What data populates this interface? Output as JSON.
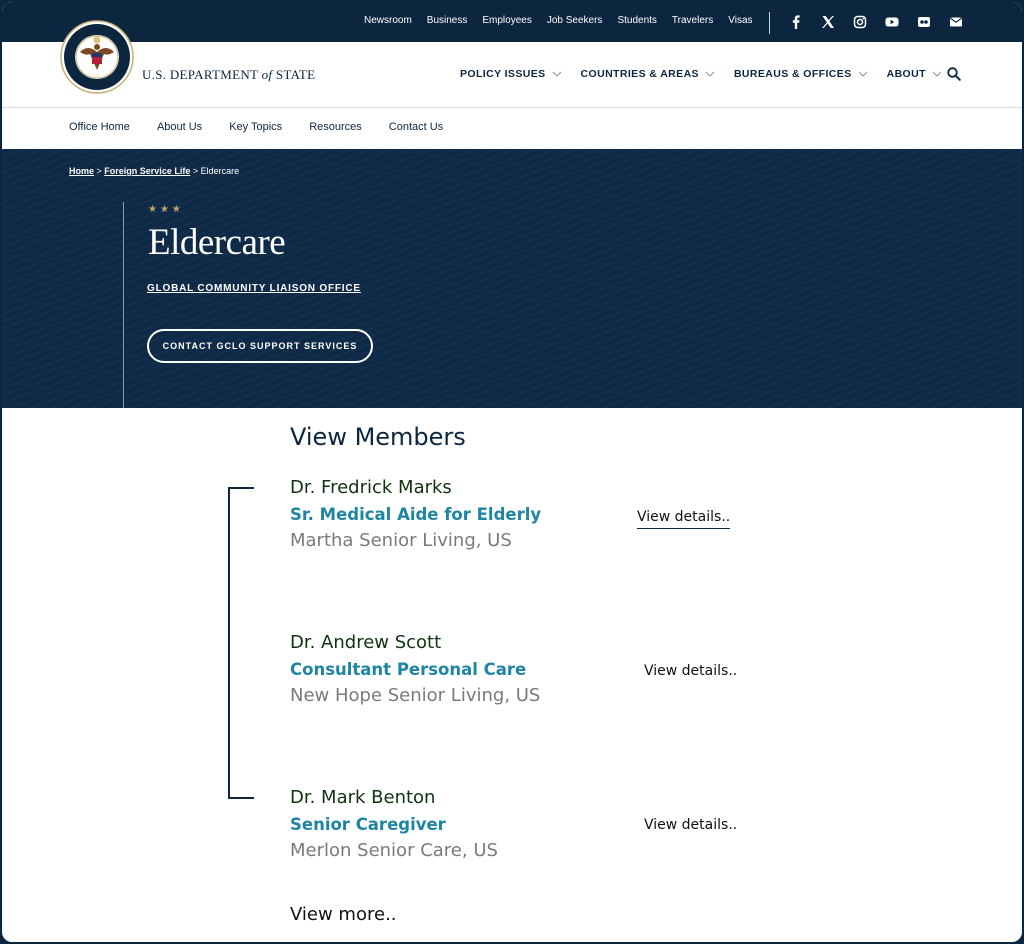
{
  "utility": {
    "links": [
      "Newsroom",
      "Business",
      "Employees",
      "Job Seekers",
      "Students",
      "Travelers",
      "Visas"
    ],
    "social": [
      "facebook-icon",
      "x-icon",
      "instagram-icon",
      "youtube-icon",
      "flickr-icon",
      "email-icon"
    ]
  },
  "header": {
    "brand_main": "U.S. DEPARTMENT",
    "brand_of": "of",
    "brand_state": "STATE",
    "nav": [
      "POLICY ISSUES",
      "COUNTRIES & AREAS",
      "BUREAUS & OFFICES",
      "ABOUT"
    ]
  },
  "subnav": [
    "Office Home",
    "About Us",
    "Key Topics",
    "Resources",
    "Contact Us"
  ],
  "hero": {
    "crumbs": [
      "Home",
      "Foreign Service Life",
      "Eldercare"
    ],
    "stars": "★★★",
    "title": "Eldercare",
    "office": "GLOBAL COMMUNITY LIAISON OFFICE",
    "cta": "CONTACT GCLO SUPPORT SERVICES"
  },
  "members": {
    "title": "View Members",
    "list": [
      {
        "name": "Dr. Fredrick Marks",
        "role": "Sr. Medical Aide for Elderly",
        "place": "Martha Senior Living, US",
        "details": "View details.."
      },
      {
        "name": "Dr. Andrew Scott",
        "role": "Consultant Personal Care",
        "place": "New Hope Senior Living, US",
        "details": "View details.."
      },
      {
        "name": "Dr. Mark Benton",
        "role": "Senior Caregiver",
        "place": "Merlon Senior Care, US",
        "details": "View details.."
      }
    ],
    "more": "View more.."
  },
  "colors": {
    "navy": "#0c2640",
    "teal": "#1f85a3",
    "gold": "#c2a46b",
    "name_green": "#10330f",
    "gray": "#777b7f"
  }
}
